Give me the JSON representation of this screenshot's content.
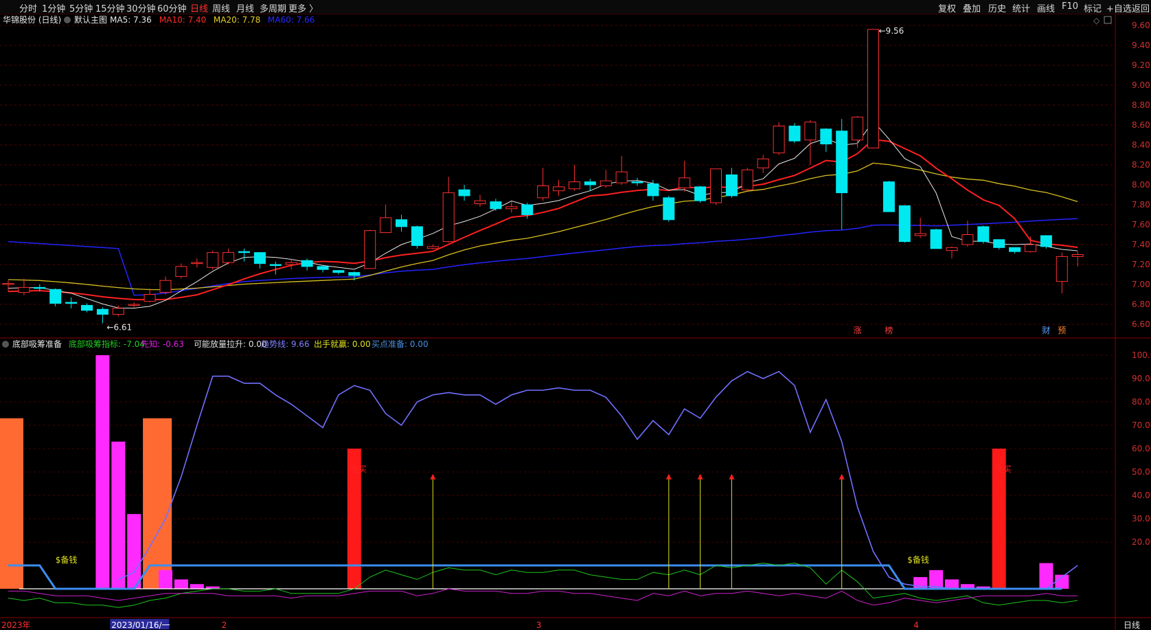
{
  "toolbar": {
    "periods": [
      "分时",
      "1分钟",
      "5分钟",
      "15分钟",
      "30分钟",
      "60分钟",
      "日线",
      "周线",
      "月线",
      "多周期",
      "更多 〉"
    ],
    "active_period": "日线",
    "right_buttons": [
      "复权",
      "叠加",
      "历史",
      "统计",
      "画线",
      "F10",
      "标记",
      "+自选",
      "返回"
    ]
  },
  "main_panel": {
    "stock": "华锦股份 (日线)",
    "template": "默认主图",
    "ma": [
      {
        "label": "MA5: 7.36",
        "color": "#e8e8e8"
      },
      {
        "label": "MA10: 7.40",
        "color": "#ff2a2a"
      },
      {
        "label": "MA20: 7.78",
        "color": "#e8d020"
      },
      {
        "label": "MA60: 7.66",
        "color": "#2a2aff"
      }
    ],
    "high_label": "9.56",
    "low_label": "6.61",
    "markers": [
      {
        "text": "涨",
        "i": 54,
        "color": "#ff4040"
      },
      {
        "text": "榜",
        "i": 56,
        "color": "#ff4040"
      },
      {
        "text": "财",
        "i": 66,
        "color": "#5aa0ff"
      },
      {
        "text": "预",
        "i": 67,
        "color": "#ff8030"
      }
    ]
  },
  "sub_panel": {
    "title": "底部吸筹准备",
    "fields": [
      {
        "label": "底部吸筹指标: -7.04",
        "color": "#20d020"
      },
      {
        "label": "先知: -0.63",
        "color": "#e020e0"
      },
      {
        "label": "可能放量拉升: 0.00",
        "color": "#e0e0e0"
      },
      {
        "label": "趋势线: 9.66",
        "color": "#8080ff"
      },
      {
        "label": "出手就赢: 0.00",
        "color": "#e0e020"
      },
      {
        "label": "买点准备: 0.00",
        "color": "#4a90e0"
      }
    ],
    "money_label": "$备钱",
    "buy_label": "建买"
  },
  "xaxis": {
    "labels": [
      {
        "text": "2023年",
        "i": 0,
        "color": "#ff3030"
      },
      {
        "text": "2023/01/16/一",
        "i": 7,
        "color": "#ffffff",
        "highlight": true
      },
      {
        "text": "2",
        "i": 14,
        "color": "#ff3030"
      },
      {
        "text": "3",
        "i": 34,
        "color": "#ff3030"
      },
      {
        "text": "4",
        "i": 58,
        "color": "#ff3030"
      }
    ],
    "period_label": "日线"
  },
  "chart_data": {
    "type": "candlestick",
    "y_main": {
      "min": 6.6,
      "max": 9.6,
      "ticks": [
        "6.60",
        "6.80",
        "7.00",
        "7.20",
        "7.40",
        "7.60",
        "7.80",
        "8.00",
        "8.20",
        "8.40",
        "8.60",
        "8.80",
        "9.00",
        "9.20",
        "9.40",
        "9.60"
      ]
    },
    "y_sub": {
      "ticks": [
        "20.00",
        "30.00",
        "40.00",
        "50.00",
        "60.00",
        "70.00",
        "80.00",
        "90.00",
        "100.0"
      ]
    },
    "candles": [
      [
        7.0,
        7.01,
        6.93,
        7.04
      ],
      [
        6.92,
        6.97,
        6.89,
        7.06
      ],
      [
        6.97,
        6.96,
        6.93,
        7.0
      ],
      [
        6.95,
        6.81,
        6.78,
        6.96
      ],
      [
        6.82,
        6.81,
        6.76,
        6.87
      ],
      [
        6.79,
        6.74,
        6.72,
        6.81
      ],
      [
        6.75,
        6.7,
        6.61,
        6.77
      ],
      [
        6.7,
        6.76,
        6.68,
        6.79
      ],
      [
        6.79,
        6.8,
        6.77,
        6.82
      ],
      [
        6.83,
        6.9,
        6.82,
        6.96
      ],
      [
        6.92,
        7.04,
        6.9,
        7.08
      ],
      [
        7.08,
        7.18,
        7.06,
        7.21
      ],
      [
        7.22,
        7.22,
        7.17,
        7.26
      ],
      [
        7.17,
        7.32,
        7.15,
        7.34
      ],
      [
        7.22,
        7.32,
        7.2,
        7.36
      ],
      [
        7.33,
        7.32,
        7.23,
        7.36
      ],
      [
        7.32,
        7.21,
        7.16,
        7.32
      ],
      [
        7.2,
        7.19,
        7.1,
        7.23
      ],
      [
        7.2,
        7.22,
        7.15,
        7.26
      ],
      [
        7.24,
        7.18,
        7.14,
        7.26
      ],
      [
        7.18,
        7.15,
        7.12,
        7.19
      ],
      [
        7.14,
        7.12,
        7.1,
        7.14
      ],
      [
        7.12,
        7.09,
        7.04,
        7.13
      ],
      [
        7.16,
        7.54,
        7.16,
        7.55
      ],
      [
        7.52,
        7.67,
        7.52,
        7.8
      ],
      [
        7.65,
        7.58,
        7.53,
        7.7
      ],
      [
        7.58,
        7.39,
        7.36,
        7.59
      ],
      [
        7.36,
        7.38,
        7.35,
        7.4
      ],
      [
        7.43,
        7.92,
        7.42,
        8.08
      ],
      [
        7.95,
        7.89,
        7.84,
        8.0
      ],
      [
        7.81,
        7.84,
        7.78,
        7.9
      ],
      [
        7.83,
        7.76,
        7.74,
        7.86
      ],
      [
        7.76,
        7.78,
        7.72,
        7.83
      ],
      [
        7.8,
        7.7,
        7.66,
        7.82
      ],
      [
        7.87,
        7.99,
        7.84,
        8.17
      ],
      [
        7.94,
        7.98,
        7.89,
        8.05
      ],
      [
        7.96,
        8.03,
        7.94,
        8.2
      ],
      [
        8.03,
        8.0,
        7.94,
        8.06
      ],
      [
        7.99,
        8.04,
        7.97,
        8.15
      ],
      [
        8.02,
        8.13,
        8.0,
        8.29
      ],
      [
        8.03,
        8.02,
        7.99,
        8.07
      ],
      [
        8.01,
        7.89,
        7.84,
        8.05
      ],
      [
        7.87,
        7.65,
        7.63,
        7.89
      ],
      [
        7.97,
        8.07,
        7.93,
        8.24
      ],
      [
        7.98,
        7.84,
        7.82,
        7.99
      ],
      [
        7.82,
        8.16,
        7.8,
        8.16
      ],
      [
        8.1,
        7.89,
        7.87,
        8.17
      ],
      [
        7.95,
        8.15,
        7.94,
        8.17
      ],
      [
        8.17,
        8.26,
        8.12,
        8.3
      ],
      [
        8.32,
        8.59,
        8.3,
        8.63
      ],
      [
        8.59,
        8.44,
        8.42,
        8.62
      ],
      [
        8.45,
        8.63,
        8.2,
        8.65
      ],
      [
        8.56,
        8.41,
        8.33,
        8.57
      ],
      [
        8.54,
        7.92,
        7.55,
        8.66
      ],
      [
        8.45,
        8.68,
        8.37,
        8.69
      ],
      [
        8.37,
        9.56,
        8.37,
        9.56
      ],
      [
        8.03,
        7.73,
        7.73,
        8.04
      ],
      [
        7.79,
        7.43,
        7.42,
        7.79
      ],
      [
        7.49,
        7.51,
        7.47,
        7.67
      ],
      [
        7.55,
        7.36,
        7.36,
        7.56
      ],
      [
        7.34,
        7.37,
        7.26,
        7.38
      ],
      [
        7.4,
        7.5,
        7.38,
        7.64
      ],
      [
        7.58,
        7.43,
        7.41,
        7.59
      ],
      [
        7.45,
        7.37,
        7.35,
        7.45
      ],
      [
        7.37,
        7.33,
        7.31,
        7.37
      ],
      [
        7.33,
        7.4,
        7.32,
        7.48
      ],
      [
        7.49,
        7.38,
        7.36,
        7.49
      ],
      [
        7.03,
        7.28,
        6.91,
        7.32
      ],
      [
        7.28,
        7.3,
        7.18,
        7.33
      ]
    ],
    "sub_bars": [
      {
        "i": 0,
        "v": 73,
        "color": "#ff6a33",
        "w": 2
      },
      {
        "i": 6,
        "v": 100,
        "color": "#ff2aff"
      },
      {
        "i": 7,
        "v": 63,
        "color": "#ff2aff"
      },
      {
        "i": 8,
        "v": 32,
        "color": "#ff2aff"
      },
      {
        "i": 9,
        "v": 73,
        "color": "#ff6a33",
        "w": 2
      },
      {
        "i": 10,
        "v": 8,
        "color": "#ff2aff"
      },
      {
        "i": 11,
        "v": 4,
        "color": "#ff2aff"
      },
      {
        "i": 12,
        "v": 2,
        "color": "#ff2aff"
      },
      {
        "i": 13,
        "v": 1,
        "color": "#ff2aff"
      },
      {
        "i": 22,
        "v": 60,
        "color": "#ff1a1a"
      },
      {
        "i": 58,
        "v": 5,
        "color": "#ff2aff"
      },
      {
        "i": 59,
        "v": 8,
        "color": "#ff2aff"
      },
      {
        "i": 60,
        "v": 4,
        "color": "#ff2aff"
      },
      {
        "i": 61,
        "v": 2,
        "color": "#ff2aff"
      },
      {
        "i": 62,
        "v": 1,
        "color": "#ff2aff"
      },
      {
        "i": 63,
        "v": 60,
        "color": "#ff1a1a"
      },
      {
        "i": 66,
        "v": 11,
        "color": "#ff2aff"
      },
      {
        "i": 67,
        "v": 6,
        "color": "#ff2aff"
      }
    ],
    "arrows": [
      27,
      42,
      44,
      46,
      53
    ],
    "trend_line": [
      null,
      null,
      null,
      null,
      null,
      null,
      null,
      4,
      7,
      18,
      30,
      48,
      70,
      91,
      91,
      88,
      88,
      83,
      79,
      74,
      69,
      83,
      87,
      85,
      75,
      70,
      80,
      83,
      84,
      83,
      83,
      79,
      83,
      85,
      85,
      86,
      85,
      85,
      82,
      74,
      64,
      72,
      66,
      77,
      73,
      82,
      89,
      93,
      90,
      93,
      87,
      67,
      81,
      63,
      35,
      16,
      5,
      2,
      1,
      1,
      0,
      0,
      0,
      0,
      0,
      0,
      0,
      5,
      10
    ]
  }
}
